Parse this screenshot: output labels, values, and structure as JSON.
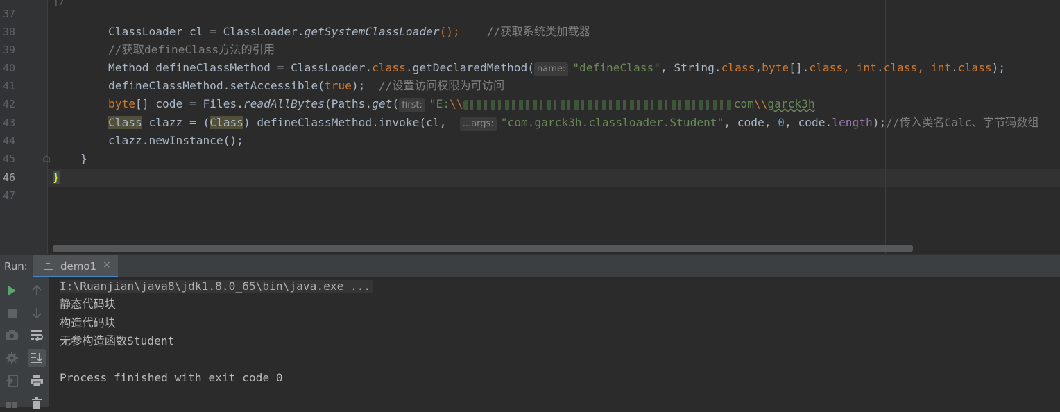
{
  "editor": {
    "line_numbers": [
      "37",
      "38",
      "39",
      "40",
      "41",
      "42",
      "43",
      "44",
      "45",
      "46",
      "47"
    ],
    "current_line": "46",
    "lines": {
      "l38": {
        "a": "ClassLoader cl = ClassLoader.",
        "b": "getSystemClassLoader",
        "c": "();    ",
        "cmt": "//获取系统类加载器"
      },
      "l39": {
        "cmt": "//获取defineClass方法的引用"
      },
      "l40": {
        "a": "Method defineClassMethod = ClassLoader.",
        "k1": "class",
        ".": ".",
        "b": ".getDeclaredMethod(",
        "hint": "name:",
        "s": "\"defineClass\"",
        "c": ", String.",
        "k2": "class",
        ",": ",",
        "k3": "byte",
        "d": "[].",
        "k4": "class",
        ", ": ", ",
        "k5": "int",
        ".2": ".",
        "k6": "class",
        ", 2": ", ",
        "k7": "int",
        ".3": ".",
        "k8": "class",
        "e": ");"
      },
      "l41": {
        "a": "defineClassMethod.setAccessible(",
        "k": "true",
        "b": ");  ",
        "cmt": "//设置访问权限为可访问"
      },
      "l42": {
        "k": "byte",
        "a": "[] code = Files.",
        "m1": "readAllBytes",
        "b": "(Paths.",
        "m2": "get",
        "c": "(",
        "hint": "first:",
        "s1": "\"E:",
        "esc": "\\\\",
        "tail1": "com",
        "esc2": "\\\\",
        "tail2": "garck3h"
      },
      "l43": {
        "cls1": "Class",
        "a": " clazz = (",
        "cls2": "Class",
        "b": ") defineClassMethod.invoke(cl,  ",
        "hint": "...args:",
        "s": "\"com.garck3h.classloader.Student\"",
        "c": ", code, ",
        "n": "0",
        "d": ", code.",
        "f": "length",
        "e": ");",
        "cmt": "//传入类名Calc、字节码数组"
      },
      "l44": {
        "a": "clazz.newInstance();"
      },
      "l45": {
        "a": "}"
      },
      "l46": {
        "a": "}"
      }
    }
  },
  "run": {
    "label": "Run:",
    "tab": "demo1",
    "close": "×"
  },
  "console": {
    "lines": [
      "I:\\Ruanjian\\java8\\jdk1.8.0_65\\bin\\java.exe ...",
      "静态代码块",
      "构造代码块",
      "无参构造函数Student",
      "",
      "Process finished with exit code 0"
    ]
  }
}
